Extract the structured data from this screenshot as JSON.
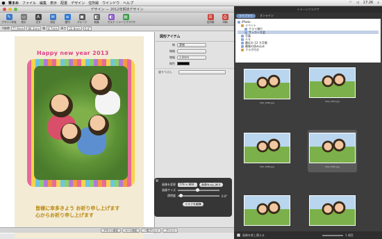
{
  "menubar": {
    "apple": "",
    "items": [
      "筆まめ",
      "ファイル",
      "編集",
      "表示",
      "配置",
      "デザイン",
      "住所録",
      "ウインドウ",
      "ヘルプ"
    ],
    "clock": "17:26"
  },
  "window": {
    "title": "デザイン — 2012年賀状デザイン",
    "toolbar": [
      {
        "label": "デザイン作成",
        "icon": "design-icon",
        "color": "#3a78c8"
      },
      {
        "label": "表示",
        "icon": "view-icon",
        "color": "#7a7a7a"
      },
      {
        "label": "文字",
        "icon": "text-icon",
        "color": "#444444"
      },
      {
        "label": "宛名",
        "icon": "address-icon",
        "color": "#3a78c8"
      },
      {
        "label": "整列",
        "icon": "align-icon",
        "color": "#2e7bd6"
      },
      {
        "label": "グループ",
        "icon": "group-icon",
        "color": "#555555"
      },
      {
        "label": "前面",
        "icon": "front-icon",
        "color": "#666666"
      },
      {
        "label": "マスク",
        "icon": "mask-icon",
        "color": "#8a5cc7"
      },
      {
        "label": "イメージブラウザ",
        "icon": "photo-browser-icon",
        "color": "#3a9a4a"
      },
      {
        "label": "住所録",
        "icon": "addressbook-icon",
        "color": "#c8443a"
      },
      {
        "label": "印刷",
        "icon": "print-icon",
        "color": "#c8443a"
      }
    ],
    "propbar": {
      "x_label": "X座標",
      "x": "77.9mm",
      "y": "86.3mm",
      "w_label": "幅",
      "w": "8.7mm",
      "h_label": "高さ",
      "h": "22.8mm",
      "angle": "0.0°"
    }
  },
  "card": {
    "title": "Happy new year 2013",
    "message_line1": "皆様に幸多きよう お祈り申し上げます",
    "message_line2": "心からお祈り申し上げます"
  },
  "inspector": {
    "heading": "図形アイテム",
    "rows": [
      {
        "label": "線",
        "value": "実線"
      },
      {
        "label": "線幅",
        "value": ""
      },
      {
        "label": "線幅",
        "value": "1.0mm"
      }
    ],
    "color_label": "線色",
    "fill_label": "塗りつぶし"
  },
  "hud": {
    "size_label": "画像を変更",
    "size_value": "779 × 860",
    "reset_button": "画像を元に戻す",
    "scale_label": "画像サイズ",
    "opacity_label": "透明度",
    "opacity_value": "0.0°",
    "edit_mask_button": "マスクを編集"
  },
  "bottombar": {
    "buttons": [
      "デザイン設定",
      "ページ設定",
      "一覧プリント",
      "プリント"
    ]
  },
  "browser": {
    "title": "イメージブラウザ",
    "tabs": [
      "ライブラリ",
      "オンライン"
    ],
    "sources": [
      {
        "label": "iPhoto",
        "color": "#8aa7d6",
        "indent": 0,
        "selected": false
      },
      {
        "label": "イベント",
        "color": "#d6a04a",
        "indent": 1,
        "selected": false
      },
      {
        "label": "クライ旅行",
        "color": "#8aa7d6",
        "indent": 2,
        "selected": false
      },
      {
        "label": "サッカー大会",
        "color": "#8aa7d6",
        "indent": 2,
        "selected": true
      },
      {
        "label": "写真",
        "color": "#8aa7d6",
        "indent": 1,
        "selected": false
      },
      {
        "label": "人々",
        "color": "#8aa7d6",
        "indent": 1,
        "selected": false
      },
      {
        "label": "最近の 12 カ月間",
        "color": "#8aa7d6",
        "indent": 1,
        "selected": false
      },
      {
        "label": "最後の読み込み",
        "color": "#8aa7d6",
        "indent": 1,
        "selected": false
      },
      {
        "label": "フラグ付き",
        "color": "#d6a04a",
        "indent": 1,
        "selected": false
      }
    ],
    "thumbs": [
      {
        "caption": "IMG_3586.jpg",
        "selected": false
      },
      {
        "caption": "IMG_3584.jpg",
        "selected": false
      },
      {
        "caption": "IMG_3588.jpg",
        "selected": false
      },
      {
        "caption": "IMG_3590.jpg",
        "selected": true
      },
      {
        "caption": "",
        "selected": false
      },
      {
        "caption": "",
        "selected": false
      }
    ],
    "footer": {
      "checkbox_label": "画像を差し替える",
      "count": "1 項目"
    }
  }
}
